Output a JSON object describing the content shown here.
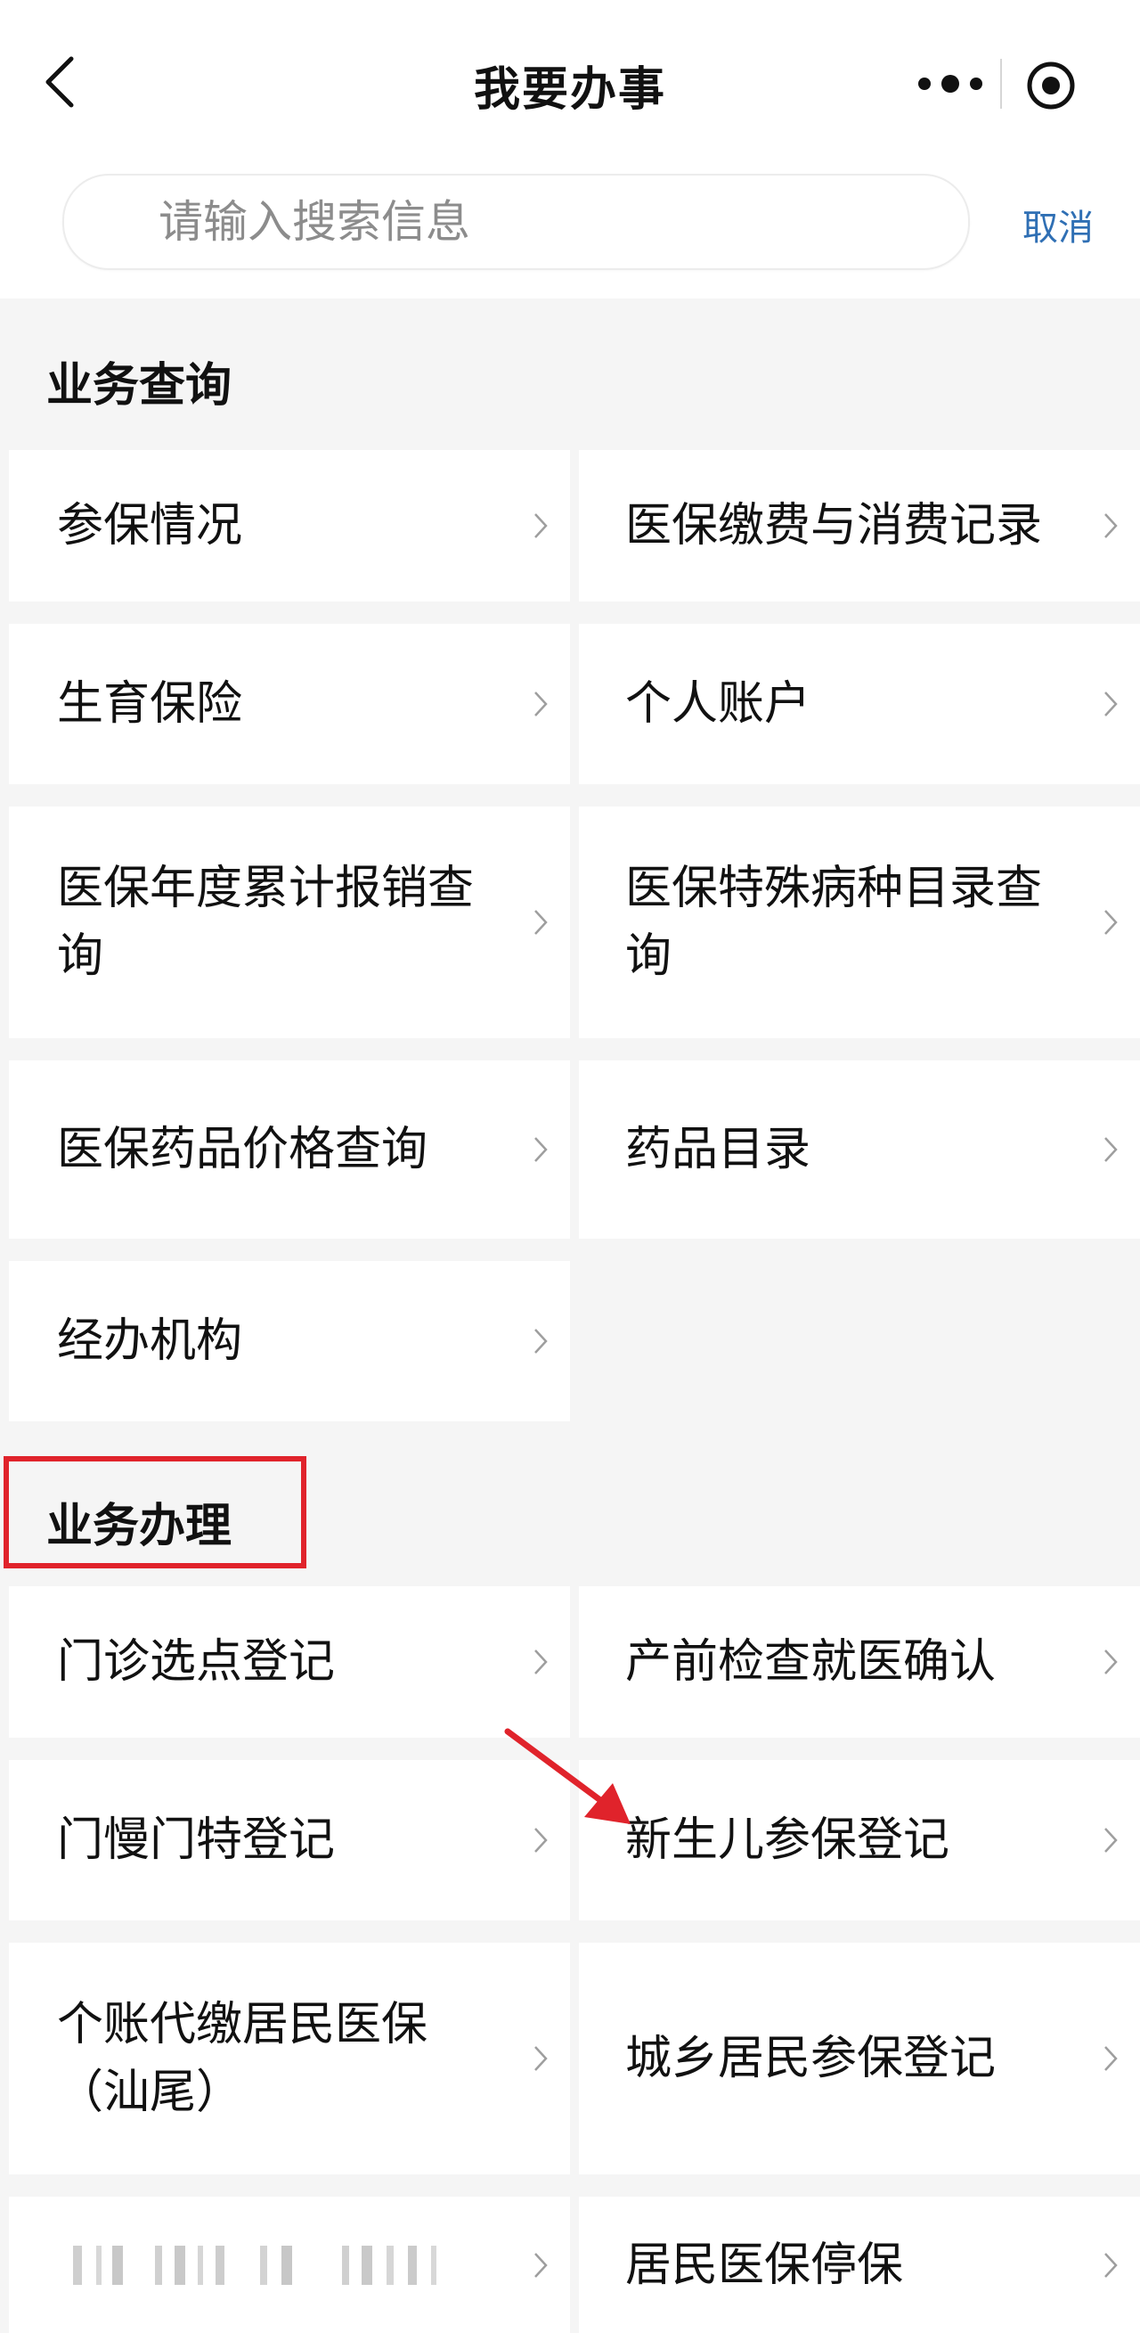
{
  "nav": {
    "title": "我要办事",
    "back_icon": "chevron-left-icon",
    "more_icon": "more-dots-icon",
    "close_icon": "target-circle-icon"
  },
  "search": {
    "placeholder": "请输入搜索信息",
    "cancel_label": "取消"
  },
  "sections": {
    "query": {
      "title": "业务查询",
      "items": [
        {
          "label": "参保情况"
        },
        {
          "label": "医保缴费与消费记录"
        },
        {
          "label": "生育保险"
        },
        {
          "label": "个人账户"
        },
        {
          "label": "医保年度累计报销查询"
        },
        {
          "label": "医保特殊病种目录查询"
        },
        {
          "label": "医保药品价格查询"
        },
        {
          "label": "药品目录"
        },
        {
          "label": "经办机构"
        }
      ]
    },
    "handle": {
      "title": "业务办理",
      "items": [
        {
          "label": "门诊选点登记"
        },
        {
          "label": "产前检查就医确认"
        },
        {
          "label": "门慢门特登记"
        },
        {
          "label": "新生儿参保登记"
        },
        {
          "label": "个账代缴居民医保（汕尾）"
        },
        {
          "label": "城乡居民参保登记"
        },
        {
          "label": ""
        },
        {
          "label": "居民医保停保"
        }
      ]
    }
  },
  "colors": {
    "accent_link": "#2f6fb4",
    "highlight_red": "#e0232b",
    "background": "#f5f5f5",
    "card": "#ffffff"
  }
}
